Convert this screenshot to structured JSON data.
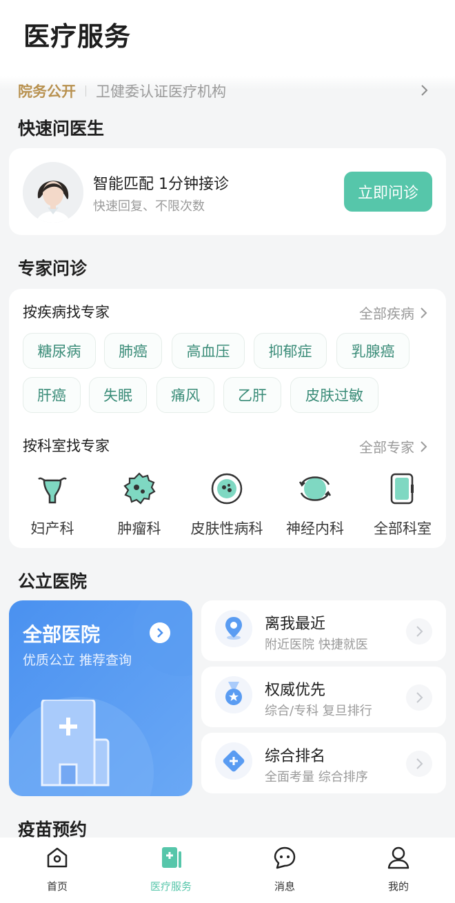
{
  "header": {
    "title": "医疗服务"
  },
  "notice": {
    "tag": "院务公开",
    "text": "卫健委认证医疗机构"
  },
  "quick": {
    "section_title": "快速问医生",
    "title": "智能匹配 1分钟接诊",
    "subtitle": "快速回复、不限次数",
    "button": "立即问诊"
  },
  "expert": {
    "section_title": "专家问诊",
    "by_disease": {
      "title": "按疾病找专家",
      "more": "全部疾病"
    },
    "diseases": [
      "糖尿病",
      "肺癌",
      "高血压",
      "抑郁症",
      "乳腺癌",
      "肝癌",
      "失眠",
      "痛风",
      "乙肝",
      "皮肤过敏"
    ],
    "by_dept": {
      "title": "按科室找专家",
      "more": "全部专家"
    },
    "departments": [
      {
        "label": "妇产科",
        "icon": "uterus-icon"
      },
      {
        "label": "肿瘤科",
        "icon": "tumor-icon"
      },
      {
        "label": "皮肤性病科",
        "icon": "skin-icon"
      },
      {
        "label": "神经内科",
        "icon": "brain-icon"
      },
      {
        "label": "全部科室",
        "icon": "door-icon"
      }
    ]
  },
  "hospitals": {
    "section_title": "公立医院",
    "main": {
      "title": "全部医院",
      "subtitle": "优质公立 推荐查询"
    },
    "items": [
      {
        "title": "离我最近",
        "subtitle": "附近医院 快捷就医",
        "icon": "location-pin-icon"
      },
      {
        "title": "权威优先",
        "subtitle": "综合/专科 复旦排行",
        "icon": "medal-icon"
      },
      {
        "title": "综合排名",
        "subtitle": "全面考量 综合排序",
        "icon": "plus-diamond-icon"
      }
    ]
  },
  "vaccine": {
    "section_title": "疫苗预约"
  },
  "nav": {
    "items": [
      {
        "label": "首页",
        "icon": "home-icon"
      },
      {
        "label": "医疗服务",
        "icon": "medical-icon"
      },
      {
        "label": "消息",
        "icon": "message-icon"
      },
      {
        "label": "我的",
        "icon": "user-icon"
      }
    ],
    "active": "医疗服务"
  },
  "colors": {
    "accent": "#56c6aa",
    "hospital_blue": "#4a91f0",
    "notice_gold": "#b8914f"
  }
}
